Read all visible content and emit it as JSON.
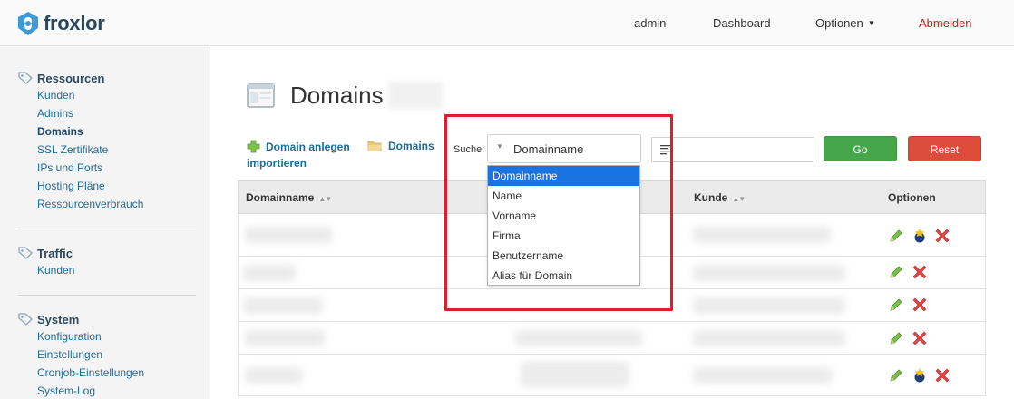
{
  "header": {
    "logo_text": "froxlor",
    "nav": {
      "admin": "admin",
      "dashboard": "Dashboard",
      "options": "Optionen",
      "logout": "Abmelden"
    }
  },
  "sidebar": {
    "sections": [
      {
        "title": "Ressourcen",
        "items": [
          "Kunden",
          "Admins",
          "Domains",
          "SSL Zertifikate",
          "IPs und Ports",
          "Hosting Pläne",
          "Ressourcenverbrauch"
        ],
        "active": "Domains"
      },
      {
        "title": "Traffic",
        "items": [
          "Kunden"
        ]
      },
      {
        "title": "System",
        "items": [
          "Konfiguration",
          "Einstellungen",
          "Cronjob-Einstellungen",
          "System-Log"
        ]
      }
    ]
  },
  "main": {
    "title": "Domains",
    "actions": {
      "add_domain": "Domain anlegen",
      "import_domains_line1": "Domains",
      "import_domains_line2": "importieren"
    },
    "search": {
      "label": "Suche:",
      "selected_field": "Domainname",
      "options": [
        "Domainname",
        "Name",
        "Vorname",
        "Firma",
        "Benutzername",
        "Alias für Domain"
      ],
      "go_label": "Go",
      "reset_label": "Reset"
    },
    "table": {
      "columns": {
        "domainname": "Domainname",
        "kunde": "Kunde",
        "optionen": "Optionen"
      },
      "rows": [
        {
          "edit": true,
          "ssl": true,
          "delete": true
        },
        {
          "edit": true,
          "ssl": false,
          "delete": true
        },
        {
          "edit": true,
          "ssl": false,
          "delete": true
        },
        {
          "edit": true,
          "ssl": false,
          "delete": true
        },
        {
          "edit": true,
          "ssl": true,
          "delete": true
        }
      ]
    }
  },
  "colors": {
    "brand": "#29485e",
    "link": "#1f6b99",
    "go": "#45a64a",
    "reset": "#dd4b3a",
    "highlight": "#e21d2a",
    "selected": "#1a73e0"
  },
  "icons": {
    "logo": "froxlor-logo-icon",
    "section": "tag-icon",
    "page": "window-icon",
    "add": "plus-icon",
    "import": "folder-icon",
    "edit": "pencil-icon",
    "ssl": "ssl-icon",
    "delete": "delete-icon",
    "filter": "list-icon"
  }
}
